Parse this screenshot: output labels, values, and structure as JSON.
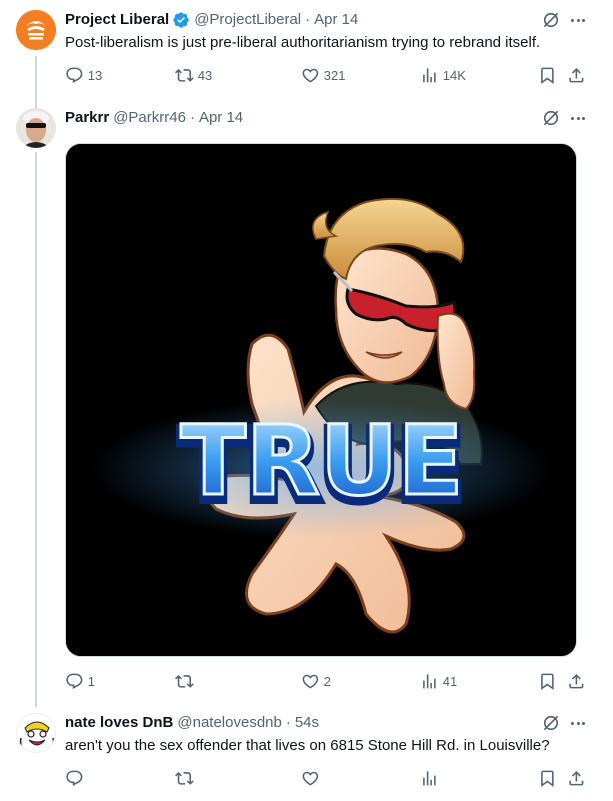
{
  "tweets": [
    {
      "name": "Project Liberal",
      "handle": "@ProjectLiberal",
      "time": "Apr 14",
      "verified": true,
      "text": "Post-liberalism is just pre-liberal authoritarianism trying to rebrand itself.",
      "replies": "13",
      "reposts": "43",
      "likes": "321",
      "views": "14K",
      "avatar_color": "#f47e20"
    },
    {
      "name": "Parkrr",
      "handle": "@Parkrr46",
      "time": "Apr 14",
      "verified": false,
      "media_text": "TRUE",
      "replies": "1",
      "reposts": "",
      "likes": "2",
      "views": "41"
    },
    {
      "name": "nate loves DnB",
      "handle": "@natelovesdnb",
      "time": "54s",
      "verified": false,
      "text": "aren't you the sex offender that lives on 6815 Stone Hill Rd. in Louisville?",
      "replies": "",
      "reposts": "",
      "likes": "",
      "views": ""
    }
  ],
  "separator": "·",
  "colors": {
    "text_primary": "#0f1419",
    "text_secondary": "#536471",
    "verified_blue": "#1d9bf0",
    "thread_line": "#cfd9de"
  },
  "icons": [
    "reply-icon",
    "repost-icon",
    "like-icon",
    "views-icon",
    "bookmark-icon",
    "share-icon",
    "grok-icon",
    "more-icon",
    "verified-badge-icon"
  ]
}
